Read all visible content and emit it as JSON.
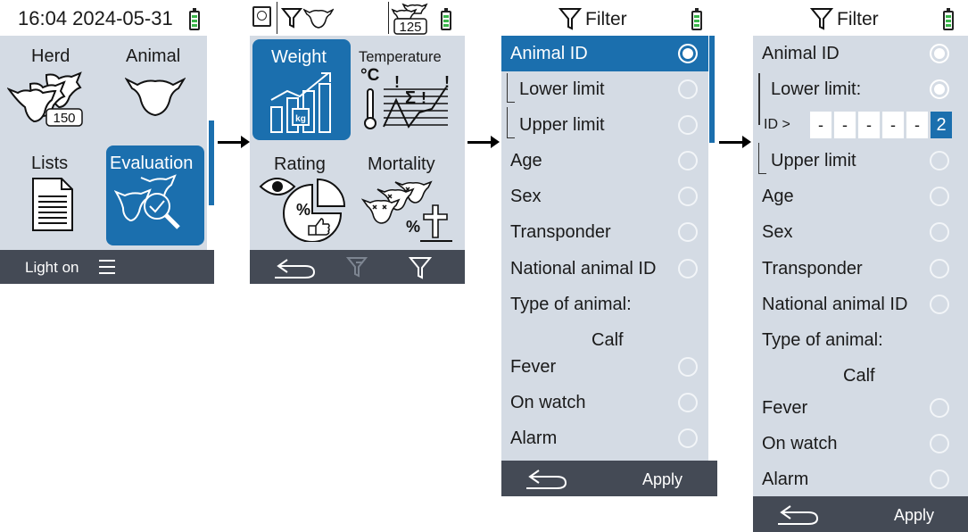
{
  "screen1": {
    "clock": "16:04 2024-05-31",
    "tiles": [
      {
        "label": "Herd",
        "badge": "150"
      },
      {
        "label": "Animal"
      },
      {
        "label": "Lists"
      },
      {
        "label": "Evaluation"
      }
    ],
    "footer": {
      "light": "Light on"
    }
  },
  "screen2": {
    "counter": "125",
    "tiles": [
      {
        "label": "Weight",
        "unit": "kg"
      },
      {
        "label": "Temperature",
        "unit": "°C",
        "sigma": "Σ"
      },
      {
        "label": "Rating",
        "percent": "%"
      },
      {
        "label": "Mortality",
        "percent": "%"
      }
    ]
  },
  "screen3": {
    "title": "Filter",
    "items": [
      {
        "label": "Animal ID"
      },
      {
        "label": "Lower limit"
      },
      {
        "label": "Upper limit"
      },
      {
        "label": "Age"
      },
      {
        "label": "Sex"
      },
      {
        "label": "Transponder"
      },
      {
        "label": "National animal ID"
      },
      {
        "label": "Type of animal:"
      },
      {
        "label": "Calf"
      },
      {
        "label": "Fever"
      },
      {
        "label": "On watch"
      },
      {
        "label": "Alarm"
      }
    ],
    "apply": "Apply"
  },
  "screen4": {
    "title": "Filter",
    "items": [
      {
        "label": "Animal ID"
      },
      {
        "label": "Lower limit:"
      },
      {
        "label": "ID >"
      },
      {
        "label": "Upper limit"
      },
      {
        "label": "Age"
      },
      {
        "label": "Sex"
      },
      {
        "label": "Transponder"
      },
      {
        "label": "National animal ID"
      },
      {
        "label": "Type of animal:"
      },
      {
        "label": "Calf"
      },
      {
        "label": "Fever"
      },
      {
        "label": "On watch"
      },
      {
        "label": "Alarm"
      }
    ],
    "id_digits": [
      "-",
      "-",
      "-",
      "-",
      "-",
      "2"
    ],
    "apply": "Apply"
  },
  "colors": {
    "accent": "#1b6fae",
    "background": "#d4dbe4",
    "footer": "#444a55",
    "battery": "#3ab54a"
  },
  "icons": [
    "battery-icon",
    "filter-icon",
    "cow-icon",
    "herd-icon",
    "document-icon",
    "search-icon",
    "chart-icon",
    "thermometer-icon",
    "eye-icon",
    "pie-icon",
    "cross-icon",
    "back-icon",
    "menu-icon",
    "filter-clear-icon"
  ]
}
